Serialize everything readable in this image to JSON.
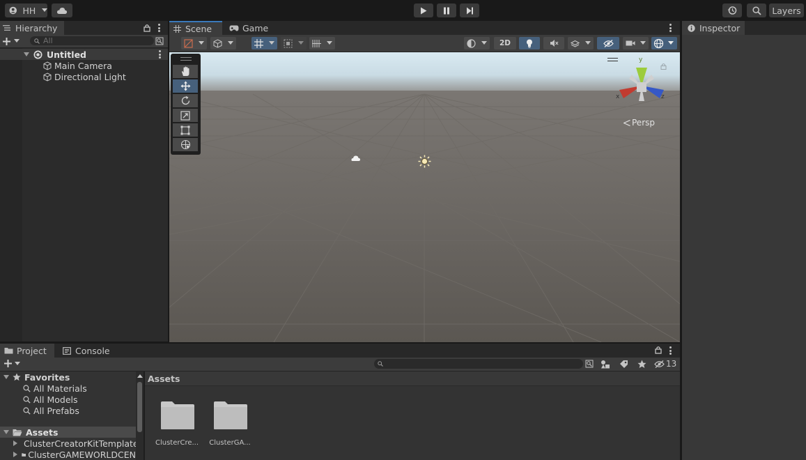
{
  "toolbar": {
    "account_label": "HH",
    "layers_label": "Layers"
  },
  "hierarchy": {
    "tab_label": "Hierarchy",
    "search_placeholder": "All",
    "scene_name": "Untitled",
    "items": [
      {
        "label": "Main Camera"
      },
      {
        "label": "Directional Light"
      }
    ]
  },
  "scene_view": {
    "tabs": [
      {
        "label": "Scene"
      },
      {
        "label": "Game"
      }
    ],
    "btn_2d": "2D",
    "projection_label": "Persp",
    "gizmo_axes": {
      "y": "y",
      "x": "x",
      "z": "z"
    }
  },
  "inspector": {
    "tab_label": "Inspector"
  },
  "bottom": {
    "tabs": [
      {
        "label": "Project"
      },
      {
        "label": "Console"
      }
    ],
    "hidden_count": "13",
    "favorites_label": "Favorites",
    "favorites": [
      {
        "label": "All Materials"
      },
      {
        "label": "All Models"
      },
      {
        "label": "All Prefabs"
      }
    ],
    "assets_root_label": "Assets",
    "asset_tree": [
      {
        "label": "ClusterCreatorKitTemplate"
      },
      {
        "label": "ClusterGAMEWORLDCEN"
      }
    ],
    "breadcrumb": "Assets",
    "grid_items": [
      {
        "label": "ClusterCre..."
      },
      {
        "label": "ClusterGA..."
      }
    ]
  },
  "colors": {
    "accent": "#3a79bb",
    "panel": "#282828",
    "sky": "#cfe3ee",
    "ground": "#5b5752"
  }
}
